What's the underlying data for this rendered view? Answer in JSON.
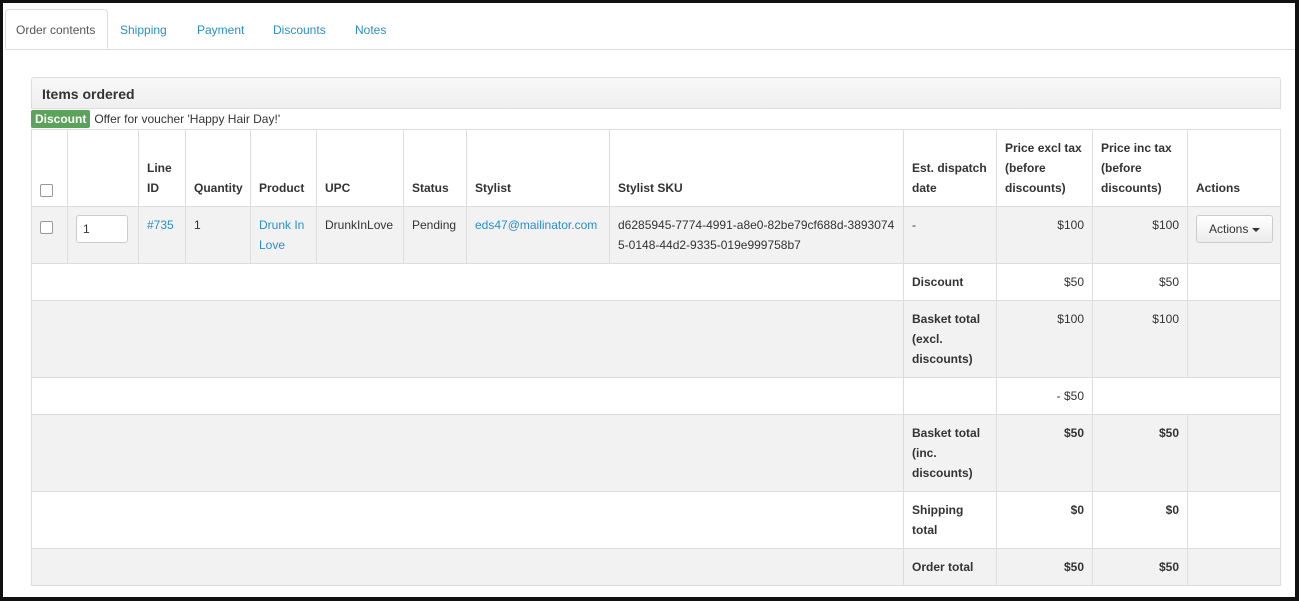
{
  "tabs": [
    {
      "label": "Order contents",
      "active": true
    },
    {
      "label": "Shipping"
    },
    {
      "label": "Payment"
    },
    {
      "label": "Discounts"
    },
    {
      "label": "Notes"
    }
  ],
  "panel": {
    "title": "Items ordered"
  },
  "discount": {
    "badge": "Discount",
    "text": "Offer for voucher 'Happy Hair Day!'"
  },
  "table": {
    "headers": {
      "line_id": "Line ID",
      "quantity": "Quantity",
      "product": "Product",
      "upc": "UPC",
      "status": "Status",
      "stylist": "Stylist",
      "stylist_sku": "Stylist SKU",
      "dispatch": "Est. dispatch date",
      "price_excl": "Price excl tax (before discounts)",
      "price_inc": "Price inc tax (before discounts)",
      "actions": "Actions"
    },
    "line": {
      "qty_input": "1",
      "line_id": "#735",
      "quantity": "1",
      "product": "Drunk In Love",
      "upc": "DrunkInLove",
      "status": "Pending",
      "stylist": "eds47@mailinator.com",
      "stylist_sku": "d6285945-7774-4991-a8e0-82be79cf688d-38930745-0148-44d2-9335-019e999758b7",
      "dispatch": "-",
      "price_excl": "$100",
      "price_inc": "$100",
      "actions_label": "Actions"
    },
    "totals": {
      "discount": {
        "label": "Discount",
        "excl": "$50",
        "inc": "$50"
      },
      "basket_excl": {
        "label": "Basket total (excl. discounts)",
        "excl": "$100",
        "inc": "$100"
      },
      "voucher_adjust": {
        "excl": "- $50"
      },
      "basket_inc": {
        "label": "Basket total (inc. discounts)",
        "excl": "$50",
        "inc": "$50"
      },
      "shipping": {
        "label": "Shipping total",
        "excl": "$0",
        "inc": "$0"
      },
      "order": {
        "label": "Order total",
        "excl": "$50",
        "inc": "$50"
      }
    }
  }
}
